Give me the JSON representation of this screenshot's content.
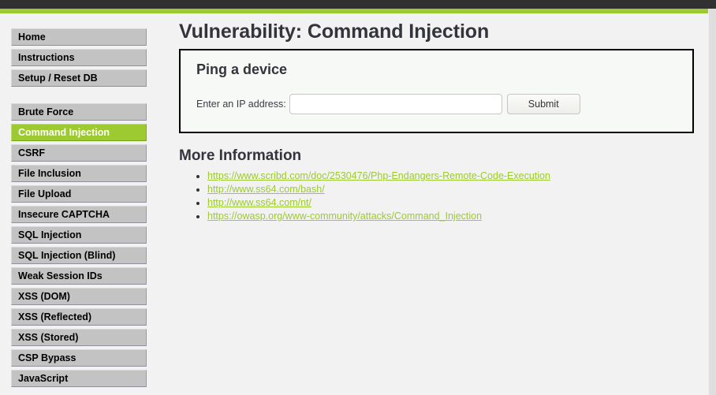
{
  "theme": {
    "top_bar_color": "#313131",
    "accent_green": "#9cca30",
    "page_background": "#f2f2f2",
    "nav_item_background": "#c3c3c3",
    "panel_background": "#f7f9f7"
  },
  "sidebar": {
    "groups": [
      {
        "items": [
          {
            "label": "Home",
            "active": false
          },
          {
            "label": "Instructions",
            "active": false
          },
          {
            "label": "Setup / Reset DB",
            "active": false
          }
        ]
      },
      {
        "items": [
          {
            "label": "Brute Force",
            "active": false
          },
          {
            "label": "Command Injection",
            "active": true
          },
          {
            "label": "CSRF",
            "active": false
          },
          {
            "label": "File Inclusion",
            "active": false
          },
          {
            "label": "File Upload",
            "active": false
          },
          {
            "label": "Insecure CAPTCHA",
            "active": false
          },
          {
            "label": "SQL Injection",
            "active": false
          },
          {
            "label": "SQL Injection (Blind)",
            "active": false
          },
          {
            "label": "Weak Session IDs",
            "active": false
          },
          {
            "label": "XSS (DOM)",
            "active": false
          },
          {
            "label": "XSS (Reflected)",
            "active": false
          },
          {
            "label": "XSS (Stored)",
            "active": false
          },
          {
            "label": "CSP Bypass",
            "active": false
          },
          {
            "label": "JavaScript",
            "active": false
          }
        ]
      }
    ]
  },
  "main": {
    "page_title": "Vulnerability: Command Injection",
    "panel": {
      "title": "Ping a device",
      "form": {
        "label": "Enter an IP address:",
        "input_value": "",
        "input_placeholder": "",
        "submit_label": "Submit"
      }
    },
    "more_information": {
      "title": "More Information",
      "links": [
        "https://www.scribd.com/doc/2530476/Php-Endangers-Remote-Code-Execution",
        "http://www.ss64.com/bash/",
        "http://www.ss64.com/nt/",
        "https://owasp.org/www-community/attacks/Command_Injection"
      ]
    }
  }
}
